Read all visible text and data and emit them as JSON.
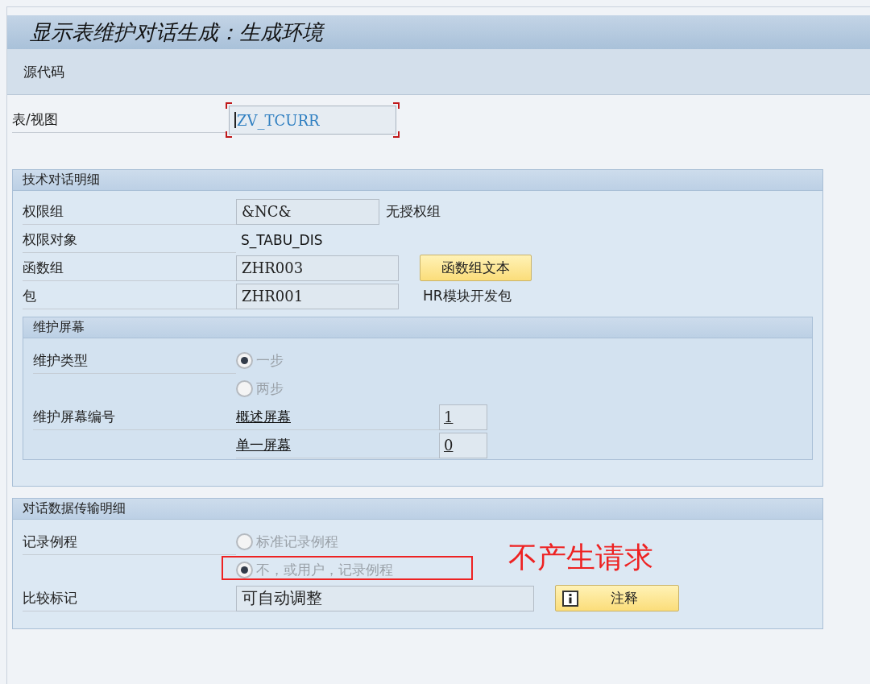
{
  "window": {
    "title": "显示表维护对话生成：生成环境"
  },
  "toolbar": {
    "items": [
      "源代码"
    ]
  },
  "table_field": {
    "label": "表/视图",
    "value": "ZV_TCURR",
    "focused": true
  },
  "tech_section": {
    "title": "技术对话明细",
    "rows": [
      {
        "kind": "field",
        "label": "权限组",
        "value": "&NC&",
        "note": "无授权组"
      },
      {
        "kind": "text",
        "label": "权限对象",
        "value": "S_TABU_DIS"
      },
      {
        "kind": "field_button",
        "label": "函数组",
        "value": "ZHR003",
        "button": "函数组文本"
      },
      {
        "kind": "field_note_wide",
        "label": "包",
        "value": "ZHR001",
        "note": "HR模块开发包"
      }
    ],
    "maintenance": {
      "title": "维护屏幕",
      "type_label": "维护类型",
      "options": [
        {
          "label": "一步",
          "selected": true
        },
        {
          "label": "两步",
          "selected": false
        }
      ],
      "number_label": "维护屏幕编号",
      "screens": [
        {
          "label": "概述屏幕",
          "value": "1"
        },
        {
          "label": "单一屏幕",
          "value": "0"
        }
      ]
    }
  },
  "transport_section": {
    "title": "对话数据传输明细",
    "routine_label": "记录例程",
    "options": [
      {
        "label": "标准记录例程",
        "selected": false,
        "highlighted": false
      },
      {
        "label": "不，或用户，记录例程",
        "selected": true,
        "highlighted": true
      }
    ],
    "annotation": "不产生请求",
    "compare_label": "比较标记",
    "compare_value": "可自动调整",
    "button": "注释"
  }
}
